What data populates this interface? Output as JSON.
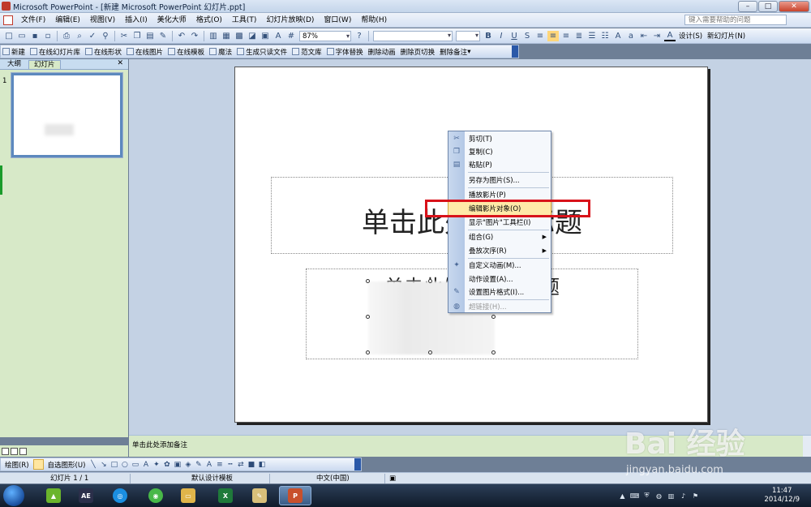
{
  "window": {
    "title": "Microsoft PowerPoint - [新建 Microsoft PowerPoint 幻灯片.ppt]"
  },
  "menu": {
    "items": [
      "文件(F)",
      "编辑(E)",
      "视图(V)",
      "插入(I)",
      "美化大师",
      "格式(O)",
      "工具(T)",
      "幻灯片放映(D)",
      "窗口(W)",
      "帮助(H)"
    ],
    "help_placeholder": "键入需要帮助的问题"
  },
  "toolbar": {
    "zoom": "87%",
    "design_label": "设计(S)",
    "new_slide_label": "新幻灯片(N)"
  },
  "toolbar2": {
    "items": [
      "新建",
      "在线幻灯片库",
      "在线形状",
      "在线图片",
      "在线模板",
      "魔法",
      "生成只读文件",
      "范文库",
      "字体替换",
      "删除动画",
      "删除页切换",
      "删除备注"
    ]
  },
  "left_panel": {
    "tabs": [
      "大纲",
      "幻灯片"
    ],
    "slide_number": "1"
  },
  "slide": {
    "title_text": "单击此处添加标题",
    "subtitle_text": "单击此处添加副标题"
  },
  "context_menu": {
    "items": [
      {
        "label": "剪切(T)",
        "icon": "scissors-icon",
        "glyph": "✂"
      },
      {
        "label": "复制(C)",
        "icon": "copy-icon",
        "glyph": "❐"
      },
      {
        "label": "粘贴(P)",
        "icon": "paste-icon",
        "glyph": "📋"
      },
      {
        "label": "另存为图片(S)...",
        "icon": "",
        "glyph": ""
      },
      {
        "label": "播放影片(P)",
        "icon": "",
        "glyph": ""
      },
      {
        "label": "编辑影片对象(O)",
        "icon": "",
        "glyph": ""
      },
      {
        "label": "显示\"图片\"工具栏(I)",
        "icon": "",
        "glyph": ""
      },
      {
        "label": "组合(G)",
        "icon": "",
        "glyph": ""
      },
      {
        "label": "叠放次序(R)",
        "icon": "",
        "glyph": ""
      },
      {
        "label": "自定义动画(M)...",
        "icon": "animation-icon",
        "glyph": "✦"
      },
      {
        "label": "动作设置(A)...",
        "icon": "",
        "glyph": ""
      },
      {
        "label": "设置图片格式(I)...",
        "icon": "format-picture-icon",
        "glyph": "✎"
      },
      {
        "label": "超链接(H)...",
        "icon": "hyperlink-icon",
        "glyph": "◍"
      }
    ],
    "highlighted": "编辑影片对象(O)"
  },
  "notes": {
    "placeholder": "单击此处添加备注"
  },
  "drawbar": {
    "draw_label": "绘图(R)",
    "autoshape_label": "自选图形(U)"
  },
  "status": {
    "slide_info": "幻灯片 1 / 1",
    "template": "默认设计模板",
    "language": "中文(中国)"
  },
  "taskbar": {
    "time": "11:47",
    "date": "2014/12/9"
  },
  "watermark": {
    "logo": "Bai 经验",
    "url": "jingyan.baidu.com"
  }
}
